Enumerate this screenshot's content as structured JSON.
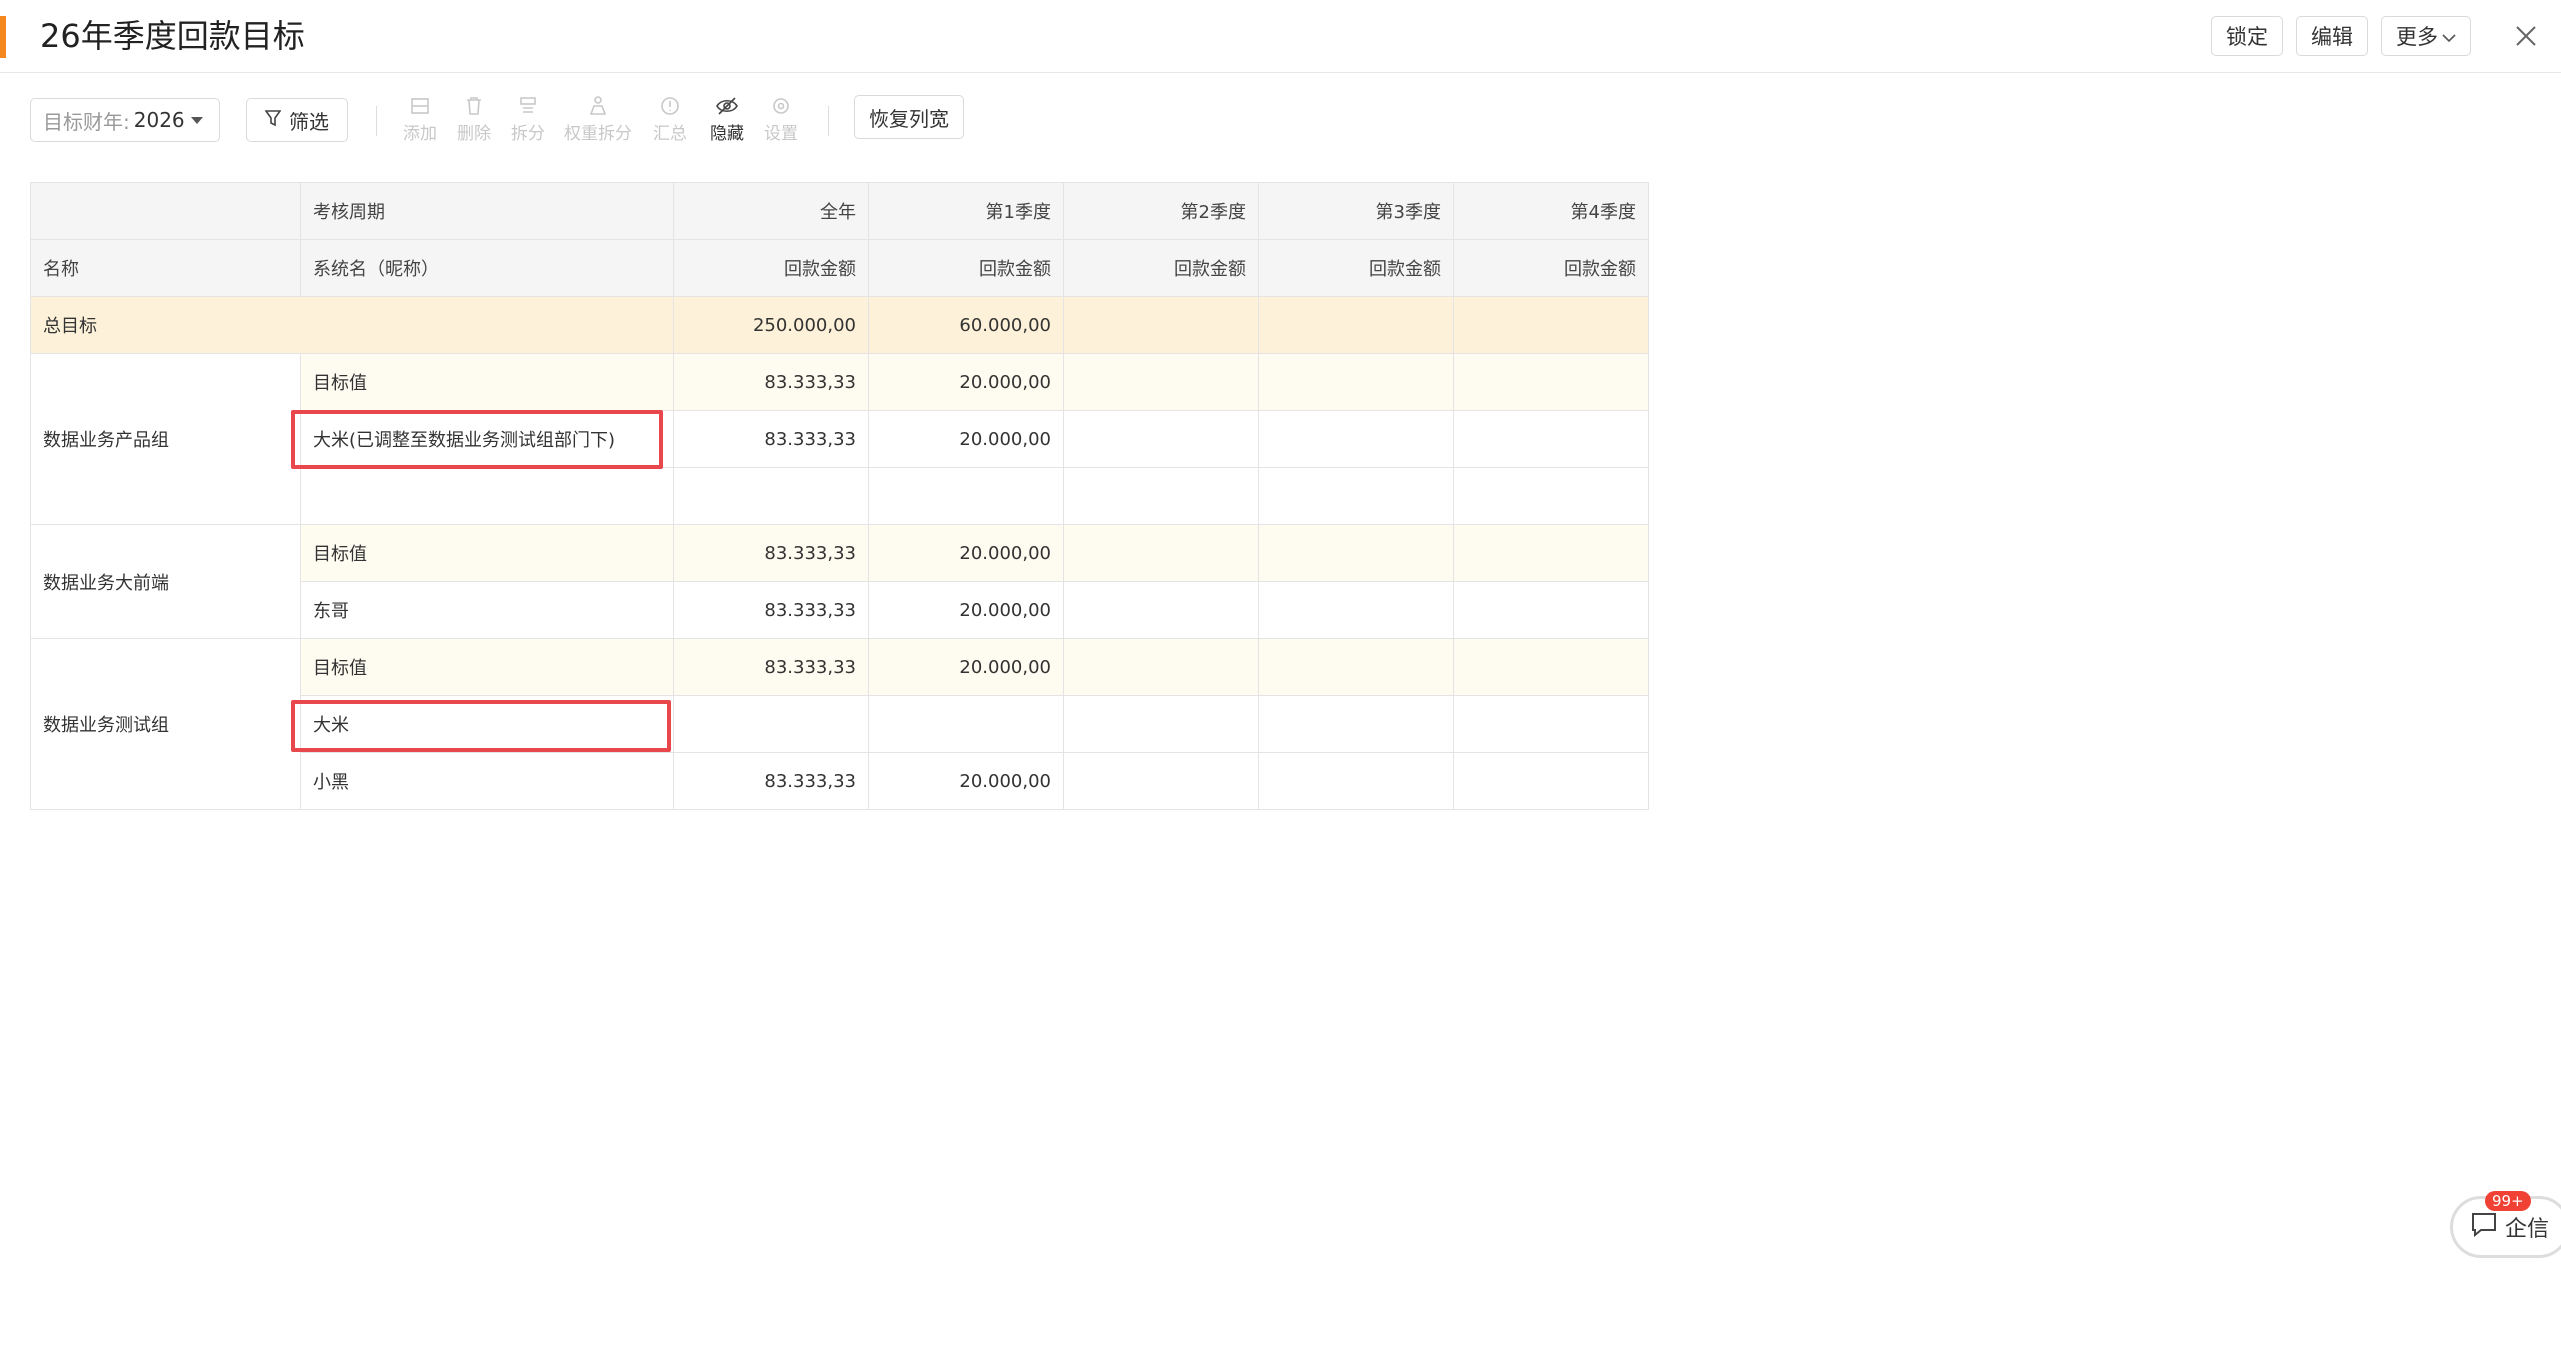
{
  "header": {
    "title": "26年季度回款目标",
    "lock_label": "锁定",
    "edit_label": "编辑",
    "more_label": "更多",
    "accent_color": "#f5871f"
  },
  "toolbar": {
    "year_label": "目标财年:",
    "year_value": "2026",
    "filter_label": "筛选",
    "tools": [
      {
        "label": "添加",
        "icon": "add-row-icon",
        "enabled": false
      },
      {
        "label": "删除",
        "icon": "trash-icon",
        "enabled": false
      },
      {
        "label": "拆分",
        "icon": "split-icon",
        "enabled": false
      },
      {
        "label": "权重拆分",
        "icon": "weight-split-icon",
        "enabled": false
      },
      {
        "label": "汇总",
        "icon": "summary-icon",
        "enabled": false
      },
      {
        "label": "隐藏",
        "icon": "eye-off-icon",
        "enabled": true
      },
      {
        "label": "设置",
        "icon": "settings-icon",
        "enabled": false
      }
    ],
    "restore_label": "恢复列宽"
  },
  "table": {
    "header_row1": [
      "",
      "考核周期",
      "全年",
      "第1季度",
      "第2季度",
      "第3季度",
      "第4季度"
    ],
    "header_row2": [
      "名称",
      "系统名（昵称）",
      "回款金额",
      "回款金额",
      "回款金额",
      "回款金额",
      "回款金额"
    ],
    "total": {
      "label": "总目标",
      "values": [
        "250.000,00",
        "60.000,00",
        "",
        "",
        ""
      ]
    },
    "groups": [
      {
        "name": "数据业务产品组",
        "rows": [
          {
            "member": "目标值",
            "is_target": true,
            "values": [
              "83.333,33",
              "20.000,00",
              "",
              "",
              ""
            ]
          },
          {
            "member": "大米(已调整至数据业务测试组部门下)",
            "is_target": false,
            "values": [
              "83.333,33",
              "20.000,00",
              "",
              "",
              ""
            ]
          },
          {
            "member": "",
            "is_target": false,
            "values": [
              "",
              "",
              "",
              "",
              ""
            ]
          }
        ]
      },
      {
        "name": "数据业务大前端",
        "rows": [
          {
            "member": "目标值",
            "is_target": true,
            "values": [
              "83.333,33",
              "20.000,00",
              "",
              "",
              ""
            ]
          },
          {
            "member": "东哥",
            "is_target": false,
            "values": [
              "83.333,33",
              "20.000,00",
              "",
              "",
              ""
            ]
          }
        ]
      },
      {
        "name": "数据业务测试组",
        "rows": [
          {
            "member": "目标值",
            "is_target": true,
            "values": [
              "83.333,33",
              "20.000,00",
              "",
              "",
              ""
            ]
          },
          {
            "member": "大米",
            "is_target": false,
            "values": [
              "",
              "",
              "",
              "",
              ""
            ]
          },
          {
            "member": "小黑",
            "is_target": false,
            "values": [
              "83.333,33",
              "20.000,00",
              "",
              "",
              ""
            ]
          }
        ]
      }
    ]
  },
  "chat": {
    "label": "企信",
    "badge": "99+"
  }
}
